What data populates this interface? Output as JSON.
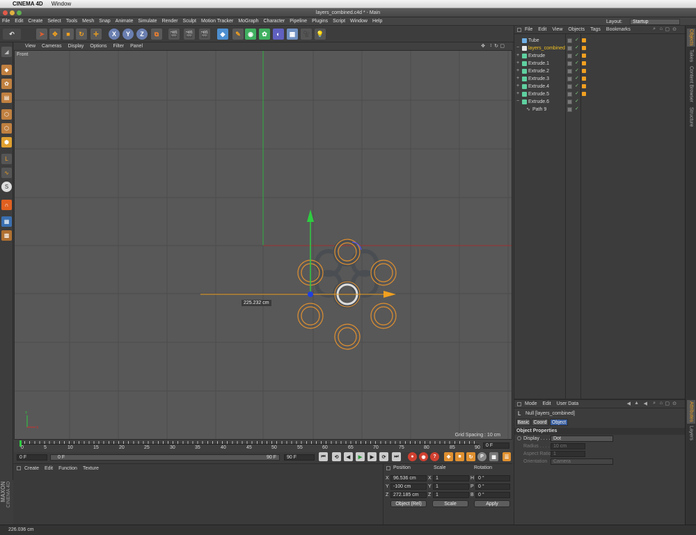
{
  "mac_menu": {
    "app_name": "CINEMA 4D",
    "window_label": "Window"
  },
  "window_title": "layers_combined.c4d * - Main",
  "main_menu": [
    "File",
    "Edit",
    "Create",
    "Select",
    "Tools",
    "Mesh",
    "Snap",
    "Animate",
    "Simulate",
    "Render",
    "Sculpt",
    "Motion Tracker",
    "MoGraph",
    "Character",
    "Pipeline",
    "Plugins",
    "Script",
    "Window",
    "Help"
  ],
  "layout": {
    "label": "Layout:",
    "value": "Startup"
  },
  "viewport": {
    "menu": [
      "View",
      "Cameras",
      "Display",
      "Options",
      "Filter",
      "Panel"
    ],
    "name": "Front",
    "measure_label": "225.232 cm",
    "grid_spacing": "Grid Spacing : 10 cm"
  },
  "timeline": {
    "ticks": [
      "0",
      "5",
      "10",
      "15",
      "20",
      "25",
      "30",
      "35",
      "40",
      "45",
      "50",
      "55",
      "60",
      "65",
      "70",
      "75",
      "80",
      "85",
      "90"
    ],
    "current_frame_right": "0 F",
    "start_frame": "0 F",
    "range_start": "0 F",
    "range_end": "90 F",
    "end_frame": "90 F"
  },
  "material_menu": [
    "Create",
    "Edit",
    "Function",
    "Texture"
  ],
  "brand": {
    "line1": "MAXON",
    "line2": "CINEMA 4D"
  },
  "coordinates": {
    "headers": [
      "Position",
      "Scale",
      "Rotation"
    ],
    "rows": [
      {
        "axis": "X",
        "pos": "96.536 cm",
        "scale_axis": "X",
        "scale": "1",
        "rot_axis": "H",
        "rot": "0 °"
      },
      {
        "axis": "Y",
        "pos": "-100 cm",
        "scale_axis": "Y",
        "scale": "1",
        "rot_axis": "P",
        "rot": "0 °"
      },
      {
        "axis": "Z",
        "pos": "272.185 cm",
        "scale_axis": "Z",
        "scale": "1",
        "rot_axis": "B",
        "rot": "0 °"
      }
    ],
    "mode": "Object (Rel)",
    "scale_mode": "Scale",
    "apply": "Apply"
  },
  "status_text": "226.036 cm",
  "objects_panel": {
    "menu": [
      "File",
      "Edit",
      "View",
      "Objects",
      "Tags",
      "Bookmarks"
    ],
    "items": [
      {
        "name": "Tube",
        "color": "#6fb0e6"
      },
      {
        "name": "layers_combined",
        "color": "#e8e8e8"
      },
      {
        "name": "Extrude",
        "color": "#5fd0a0"
      },
      {
        "name": "Extrude.1",
        "color": "#5fd0a0"
      },
      {
        "name": "Extrude.2",
        "color": "#5fd0a0"
      },
      {
        "name": "Extrude.3",
        "color": "#5fd0a0"
      },
      {
        "name": "Extrude.4",
        "color": "#5fd0a0"
      },
      {
        "name": "Extrude.5",
        "color": "#5fd0a0"
      },
      {
        "name": "Extrude.6",
        "color": "#5fd0a0"
      },
      {
        "name": "Path 9",
        "color": "#bbbbbb"
      }
    ]
  },
  "attributes": {
    "menu": [
      "Mode",
      "Edit",
      "User Data"
    ],
    "object_title": "Null [layers_combined]",
    "tabs": [
      "Basic",
      "Coord",
      "Object"
    ],
    "section": "Object Properties",
    "props": [
      {
        "label": "Display . . . . .",
        "value": "Dot"
      },
      {
        "label": "Radius . . . . .",
        "value": "10 cm"
      },
      {
        "label": "Aspect Ratio",
        "value": "1"
      },
      {
        "label": "Orientation",
        "value": "Camera"
      }
    ]
  },
  "side_tabs": {
    "right_top": [
      "Objects",
      "Takes",
      "Content Browser",
      "Structure"
    ],
    "right_bottom": [
      "Attributes",
      "Layers"
    ]
  },
  "colors": {
    "accent_orange": "#f0a020",
    "axis_green": "#2ecc40",
    "axis_red": "#c03030",
    "viewport_bg": "#585858",
    "selected_obj": "#f0c020"
  }
}
